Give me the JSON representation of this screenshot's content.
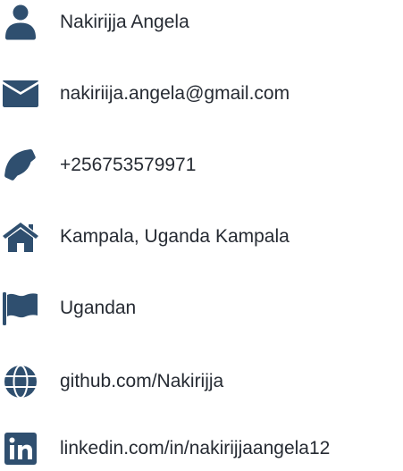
{
  "colors": {
    "icon": "#2f4f6f",
    "text": "#262b33",
    "background": "#ffffff"
  },
  "contact": {
    "items": [
      {
        "icon": "user-icon",
        "text": "Nakirijja Angela"
      },
      {
        "icon": "envelope-icon",
        "text": "nakiriija.angela@gmail.com"
      },
      {
        "icon": "phone-icon",
        "text": "+256753579971"
      },
      {
        "icon": "home-icon",
        "text": "Kampala, Uganda Kampala"
      },
      {
        "icon": "flag-icon",
        "text": "Ugandan"
      },
      {
        "icon": "globe-icon",
        "text": "github.com/Nakirijja"
      },
      {
        "icon": "linkedin-icon",
        "text": "linkedin.com/in/nakirijjaangela12"
      }
    ]
  }
}
